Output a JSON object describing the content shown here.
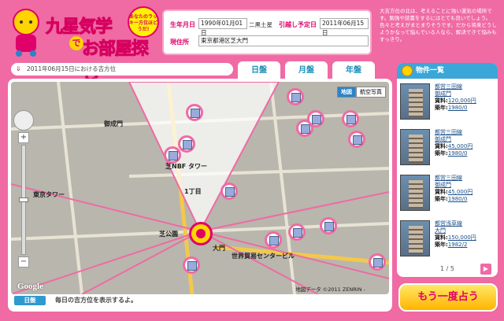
{
  "logo": {
    "title_line1": "九星気学",
    "title_de": "で",
    "title_line2": "お部屋探し",
    "badge": "あなたのラッキー方位ほどうだ!"
  },
  "form": {
    "birthdate_label": "生年月日",
    "birthdate_value": "1990年01月01日",
    "birthstar": "二黒土星",
    "move_label": "引越し予定日",
    "move_value": "2011年06月15日",
    "address_label": "現住所",
    "address_value": "東京都港区芝大門"
  },
  "description": "大吉方位の北は、考えることに強い運気の場所です。勉強や読書をするにはとても良いでしょう。色々と考えがまとまりそうです。だから将来どうしようかなって悩んでいる人なら、解決できて悩みもすっきり。",
  "datebar": {
    "text": "2011年06月15日における吉方位",
    "chevron": "⇓"
  },
  "tabs": [
    {
      "label": "日盤",
      "active": true
    },
    {
      "label": "月盤",
      "active": false
    },
    {
      "label": "年盤",
      "active": false
    }
  ],
  "map": {
    "type_map": "地図",
    "type_satellite": "航空写真",
    "zoom_in": "+",
    "zoom_out": "−",
    "google": "Google",
    "copyright": "地図データ ©2011 ZENRIN -",
    "labels": [
      "御成門",
      "東京タワー",
      "芝公園",
      "芝NBF タワー",
      "1丁目",
      "大門",
      "世界貿易センタービル"
    ]
  },
  "footer": {
    "button": "日盤",
    "message": "毎日の吉方位を表示するよ。"
  },
  "panel": {
    "title": "物件一覧",
    "listings": [
      {
        "line": "都営三田線",
        "station": "御成門",
        "rent_label": "賃料:",
        "rent": "120,000円",
        "built_label": "築年:",
        "built": "1980/0"
      },
      {
        "line": "都営三田線",
        "station": "御成門",
        "rent_label": "賃料:",
        "rent": "45,000円",
        "built_label": "築年:",
        "built": "1980/0"
      },
      {
        "line": "都営三田線",
        "station": "御成門",
        "rent_label": "賃料:",
        "rent": "45,000円",
        "built_label": "築年:",
        "built": "1980/0"
      },
      {
        "line": "都営浅草線",
        "station": "大門",
        "rent_label": "賃料:",
        "rent": "150,000円",
        "built_label": "築年:",
        "built": "1982/2"
      }
    ],
    "pager": "1 / 5",
    "next": "▶"
  },
  "retry_button": "もう一度占う",
  "colors": {
    "accent": "#f06aa4",
    "brand": "#e0006a",
    "blue": "#3aa7d8"
  }
}
